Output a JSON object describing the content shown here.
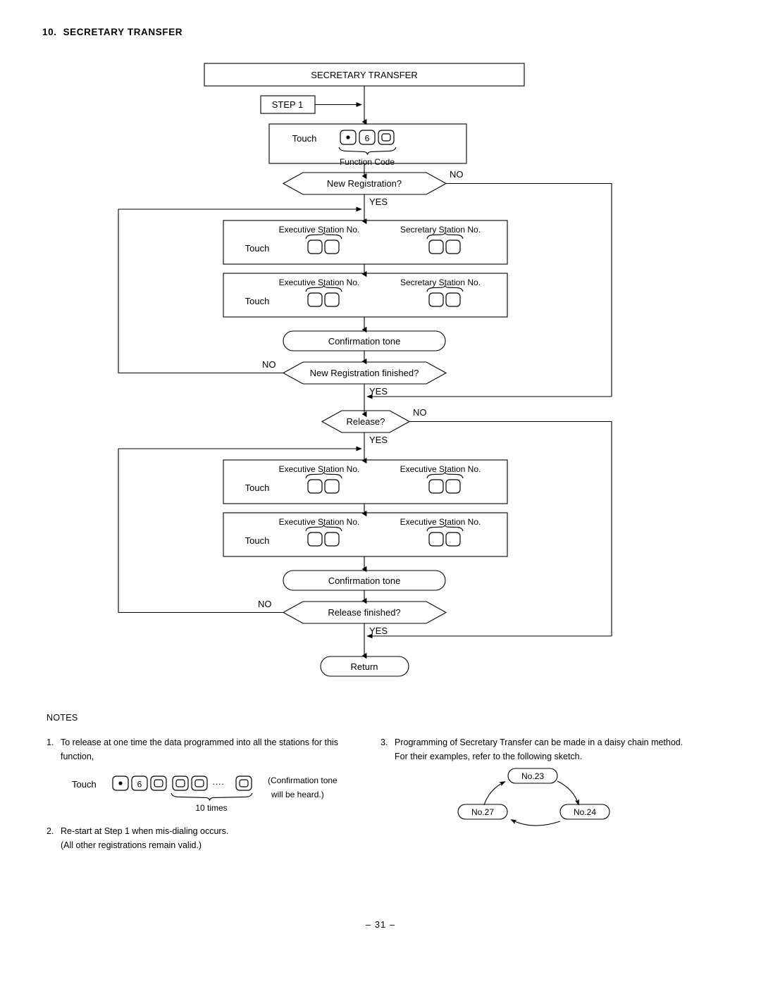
{
  "heading": {
    "number": "10.",
    "title": "SECRETARY  TRANSFER"
  },
  "flow": {
    "title_box": "SECRETARY  TRANSFER",
    "step_box": "STEP  1",
    "function_code": {
      "touch_label": "Touch",
      "caption": "Function  Code",
      "keys": [
        "dot-key",
        "6",
        "blank"
      ]
    },
    "decisions": [
      {
        "id": "new-registration",
        "text": "New  Registration?",
        "yes": "YES",
        "no": "NO"
      },
      {
        "id": "new-registration-finished",
        "text": "New  Registration  finished?",
        "yes": "YES",
        "no": "NO"
      },
      {
        "id": "release",
        "text": "Release?",
        "yes": "YES",
        "no": "NO"
      },
      {
        "id": "release-finished",
        "text": "Release  finished?",
        "yes": "YES",
        "no": "NO"
      }
    ],
    "touch_blocks": [
      {
        "id": "new-reg-1",
        "touch_label": "Touch",
        "left_label": "Executive  Station  No.",
        "right_label": "Secretary  Station  No."
      },
      {
        "id": "new-reg-2",
        "touch_label": "Touch",
        "left_label": "Executive  Station  No.",
        "right_label": "Secretary  Station  No."
      },
      {
        "id": "release-1",
        "touch_label": "Touch",
        "left_label": "Executive  Station  No.",
        "right_label": "Executive  Station  No."
      },
      {
        "id": "release-2",
        "touch_label": "Touch",
        "left_label": "Executive  Station  No.",
        "right_label": "Executive  Station  No."
      }
    ],
    "confirmation_tone_1": "Confirmation  tone",
    "confirmation_tone_2": "Confirmation  tone",
    "return_box": "Return"
  },
  "notes": {
    "title": "NOTES",
    "items": [
      {
        "number": "1.",
        "line1": "To release at one time the data programmed into all the stations for this",
        "line2": "function,",
        "touch_label": "Touch",
        "keys": [
          "dot-key",
          "6",
          "blank",
          "blank",
          "blank",
          "dots",
          "blank"
        ],
        "dots": "····",
        "brace_caption": "10  times",
        "result_line1": "(Confirmation  tone",
        "result_line2": "will  be  heard.)"
      },
      {
        "number": "2.",
        "line1": "Re-start at Step  1  when  mis-dialing  occurs.",
        "line2": "(All  other  registrations  remain  valid.)"
      },
      {
        "number": "3.",
        "line1": "Programming of Secretary Transfer can be made in a daisy chain method.",
        "line2": "For  their  examples,  refer  to  the  following  sketch."
      }
    ],
    "daisy_chain": {
      "nodes": [
        {
          "id": "node-top",
          "label": "No.23"
        },
        {
          "id": "node-bottom-right",
          "label": "No.24"
        },
        {
          "id": "node-bottom-left",
          "label": "No.27"
        }
      ]
    }
  },
  "page_number": "– 31 –",
  "colors": {
    "ink": "#000000",
    "paper": "#ffffff"
  }
}
